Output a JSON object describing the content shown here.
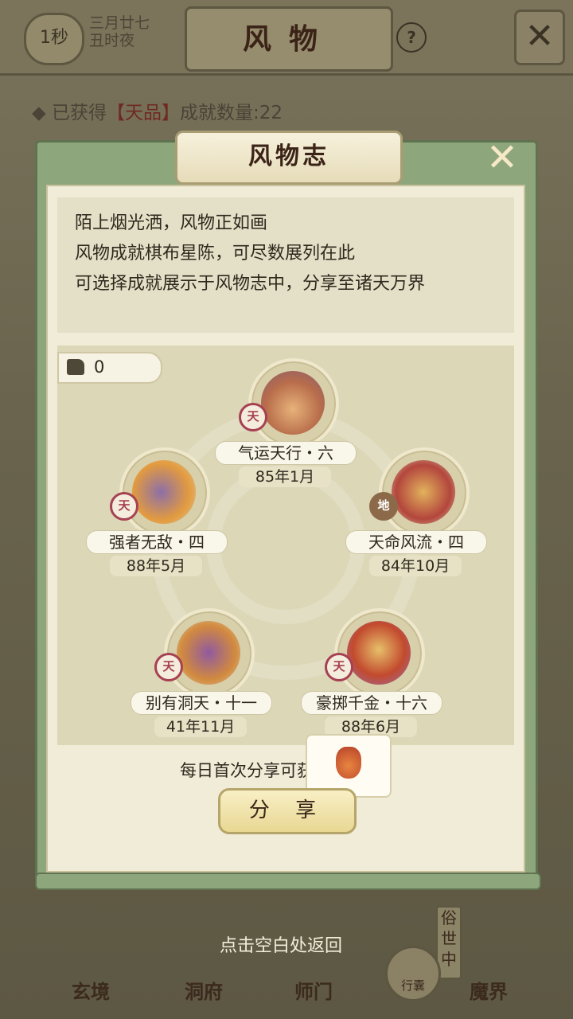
{
  "topbar": {
    "timer": "1秒",
    "date_line1": "三月廿七",
    "date_line2": "丑时夜",
    "title": "风物",
    "help": "?"
  },
  "achievement_summary": {
    "prefix": "已获得",
    "tag": "【天品】",
    "suffix": "成就数量:22"
  },
  "modal": {
    "title": "风物志",
    "description": [
      "陌上烟光洒，风物正如画",
      "风物成就棋布星陈，可尽数展列在此",
      "可选择成就展示于风物志中，分享至诸天万界"
    ],
    "likes": "0",
    "achievements": [
      {
        "name": "气运天行・六",
        "date": "85年1月",
        "grade": "天",
        "icon": "fortune-bag-icon"
      },
      {
        "name": "强者无敌・四",
        "date": "88年5月",
        "grade": "天",
        "icon": "flaming-sword-icon"
      },
      {
        "name": "天命风流・四",
        "date": "84年10月",
        "grade": "地",
        "icon": "qilin-deer-icon"
      },
      {
        "name": "别有洞天・十一",
        "date": "41年11月",
        "grade": "天",
        "icon": "dragon-head-icon"
      },
      {
        "name": "豪掷千金・十六",
        "date": "88年6月",
        "grade": "天",
        "icon": "pavilion-gold-icon"
      }
    ],
    "share_tip": "每日首次分享可获得奖励",
    "share_button": "分 享"
  },
  "back_hint": "点击空白处返回",
  "nav": {
    "items": [
      "玄境",
      "洞府",
      "师门",
      "魔界"
    ],
    "pack": "行囊",
    "vertical_tab": "俗世中"
  }
}
